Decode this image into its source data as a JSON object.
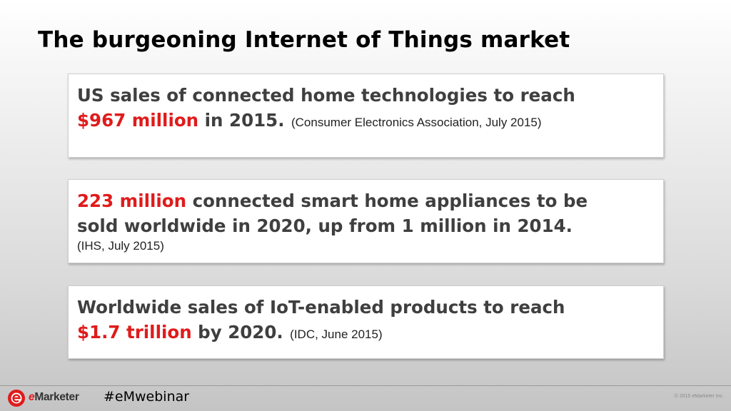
{
  "slide": {
    "title": "The burgeoning Internet of Things market"
  },
  "cards": [
    {
      "line1": "US sales of connected home technologies to reach",
      "highlight": "$967 million",
      "line2_rest": " in 2015.",
      "source": "(Consumer Electronics Association, July 2015)"
    },
    {
      "highlight": "223 million",
      "line1_rest": " connected smart home appliances to be",
      "line2": "sold worldwide in 2020, up from 1 million in 2014.",
      "source": "(IHS, July 2015)"
    },
    {
      "line1": "Worldwide sales of IoT-enabled products to reach",
      "highlight": "$1.7 trillion",
      "line2_rest": " by 2020.",
      "source": "(IDC, June 2015)"
    }
  ],
  "footer": {
    "brand_e": "e",
    "brand_rest": "Marketer",
    "hashtag": "#eMwebinar",
    "copyright": "© 2015 eMarketer Inc."
  },
  "colors": {
    "highlight": "#e01b1b",
    "body_text": "#3f3f3f",
    "logo": "#e01b1b"
  },
  "icons": {
    "logo": "emarketer-logo-icon"
  }
}
